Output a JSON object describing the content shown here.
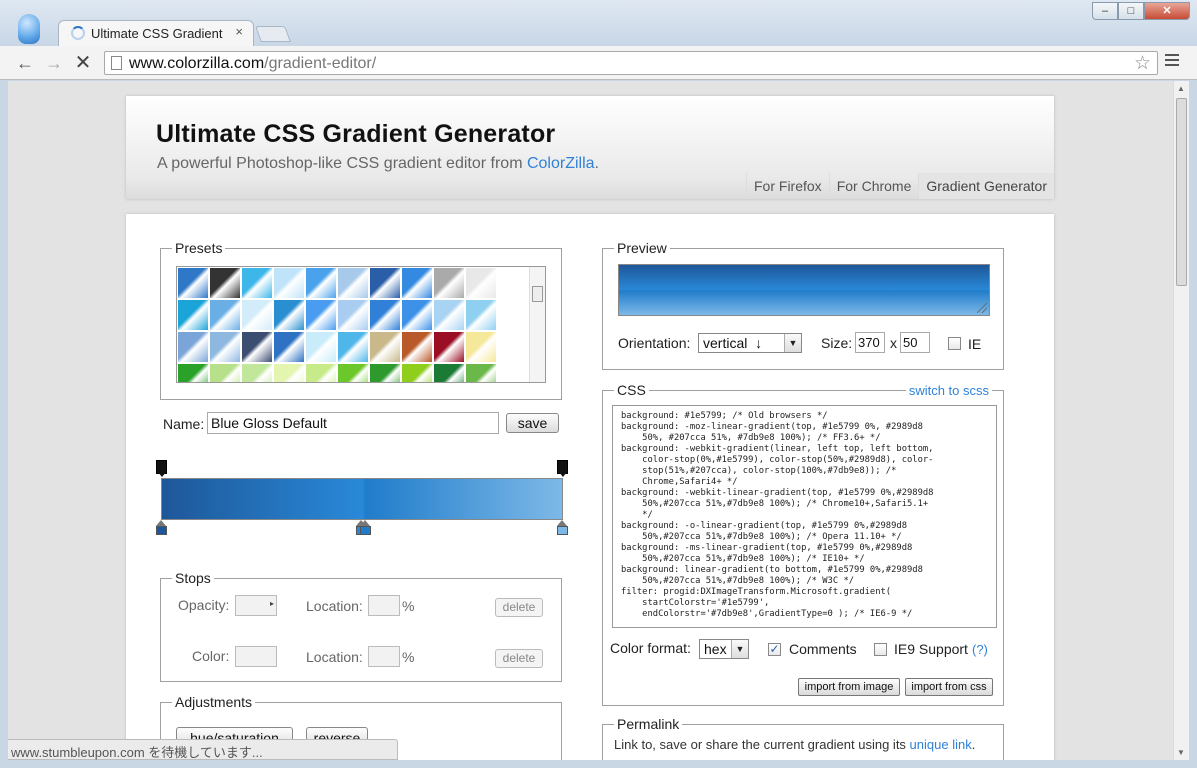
{
  "browser": {
    "tab_title": "Ultimate CSS Gradient",
    "tab_close": "×",
    "url_host": "www.colorzilla.com",
    "url_path": "/gradient-editor/",
    "status_text": "www.stumbleupon.com を待機しています..."
  },
  "header": {
    "title": "Ultimate CSS Gradient Generator",
    "subtitle_prefix": "A powerful Photoshop-like CSS gradient editor from ",
    "subtitle_link": "ColorZilla",
    "subtitle_suffix": ".",
    "tabs": [
      "For Firefox",
      "For Chrome",
      "Gradient Generator"
    ]
  },
  "presets": {
    "legend": "Presets",
    "rows": [
      [
        "#2f78c8",
        "#333333",
        "#3db7ea",
        "#bfe3f8",
        "#4aa2ec",
        "#a7c9ea",
        "#2a5ea8",
        "#3489e0",
        "#aaaaaa",
        "#e8e8e8",
        "#ffffff"
      ],
      [
        "#1aa4d8",
        "#6aaee6",
        "#d3ecfa",
        "#2a8fd0",
        "#4a9cf0",
        "#a8cdf0",
        "#2f80d6",
        "#3d92e8",
        "#a9d3f2",
        "#8fd0f0",
        "#ffffff"
      ],
      [
        "#7ba5d8",
        "#8fb8e0",
        "#3b4d70",
        "#2f72c4",
        "#c9ecfa",
        "#4fb6ea",
        "#c8b88a",
        "#b85a2a",
        "#9a0f24",
        "#f6e89a",
        "#ffffff"
      ],
      [
        "#2aa22a",
        "#b7e08a",
        "#c0e79a",
        "#e4f5b0",
        "#c7eb8a",
        "#6cc82a",
        "#2e9a2e",
        "#8fce1a",
        "#1b7a34",
        "#6ab84a",
        "#ffffff"
      ]
    ]
  },
  "name_field": {
    "label": "Name:",
    "value": "Blue Gloss Default",
    "save_label": "save"
  },
  "gradient": {
    "stops": [
      {
        "color": "#1e5799",
        "location": 0
      },
      {
        "color": "#2989d8",
        "location": 50
      },
      {
        "color": "#207cca",
        "location": 51
      },
      {
        "color": "#7db9e8",
        "location": 100
      }
    ]
  },
  "stops_panel": {
    "legend": "Stops",
    "opacity_label": "Opacity:",
    "color_label": "Color:",
    "location_label": "Location:",
    "percent": "%",
    "delete_label": "delete"
  },
  "adjustments": {
    "legend": "Adjustments",
    "hue_saturation": "hue/saturation",
    "reverse": "reverse"
  },
  "preview": {
    "legend": "Preview",
    "orientation_label": "Orientation:",
    "orientation_value": "vertical  ↓",
    "size_label": "Size:",
    "width": "370",
    "x": "x",
    "height": "50",
    "ie_label": "IE"
  },
  "css": {
    "legend": "CSS",
    "switch_link": "switch to scss",
    "code": "background: #1e5799; /* Old browsers */\nbackground: -moz-linear-gradient(top, #1e5799 0%, #2989d8\n    50%, #207cca 51%, #7db9e8 100%); /* FF3.6+ */\nbackground: -webkit-gradient(linear, left top, left bottom,\n    color-stop(0%,#1e5799), color-stop(50%,#2989d8), color-\n    stop(51%,#207cca), color-stop(100%,#7db9e8)); /*\n    Chrome,Safari4+ */\nbackground: -webkit-linear-gradient(top, #1e5799 0%,#2989d8\n    50%,#207cca 51%,#7db9e8 100%); /* Chrome10+,Safari5.1+\n    */\nbackground: -o-linear-gradient(top, #1e5799 0%,#2989d8\n    50%,#207cca 51%,#7db9e8 100%); /* Opera 11.10+ */\nbackground: -ms-linear-gradient(top, #1e5799 0%,#2989d8\n    50%,#207cca 51%,#7db9e8 100%); /* IE10+ */\nbackground: linear-gradient(to bottom, #1e5799 0%,#2989d8\n    50%,#207cca 51%,#7db9e8 100%); /* W3C */\nfilter: progid:DXImageTransform.Microsoft.gradient(\n    startColorstr='#1e5799',\n    endColorstr='#7db9e8',GradientType=0 ); /* IE6-9 */",
    "color_format_label": "Color format:",
    "color_format_value": "hex",
    "comments_label": "Comments",
    "comments_checked": "✓",
    "ie9_label": "IE9 Support",
    "ie9_help": "(?)",
    "import_image": "import from image",
    "import_css": "import from css"
  },
  "permalink": {
    "legend": "Permalink",
    "text_prefix": "Link to, save or share the current gradient using its ",
    "link": "unique link",
    "text_suffix": "."
  }
}
